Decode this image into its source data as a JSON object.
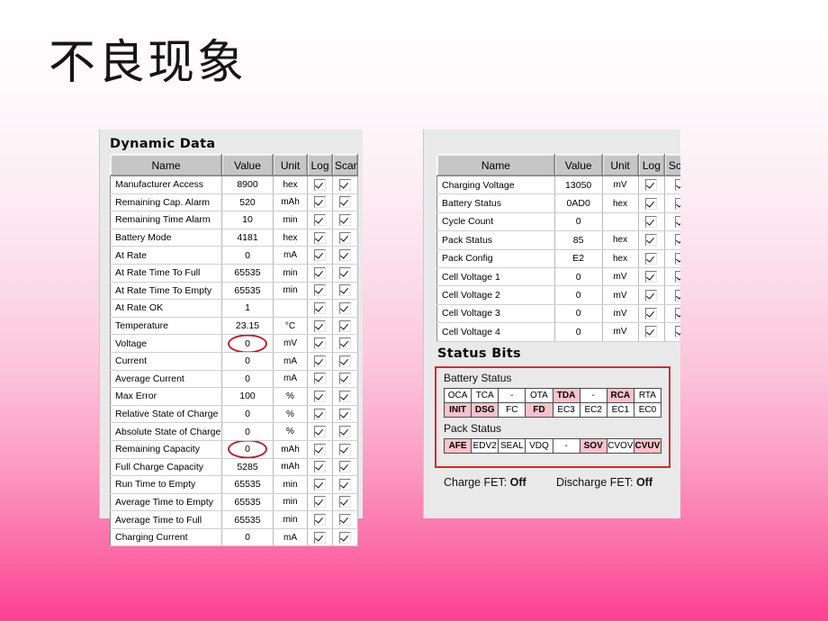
{
  "slide": {
    "title": "不良现象"
  },
  "dynamic_data": {
    "group_title": "Dynamic Data",
    "columns": [
      "Name",
      "Value",
      "Unit",
      "Log",
      "Scan"
    ],
    "rows": [
      {
        "name": "Manufacturer Access",
        "value": "8900",
        "unit": "hex",
        "log": true,
        "scan": true,
        "mark": "none"
      },
      {
        "name": "Remaining Cap. Alarm",
        "value": "520",
        "unit": "mAh",
        "log": true,
        "scan": true,
        "mark": "none"
      },
      {
        "name": "Remaining Time Alarm",
        "value": "10",
        "unit": "min",
        "log": true,
        "scan": true,
        "mark": "none"
      },
      {
        "name": "Battery Mode",
        "value": "4181",
        "unit": "hex",
        "log": true,
        "scan": true,
        "mark": "none"
      },
      {
        "name": "At Rate",
        "value": "0",
        "unit": "mA",
        "log": true,
        "scan": true,
        "mark": "none"
      },
      {
        "name": "At Rate Time To Full",
        "value": "65535",
        "unit": "min",
        "log": true,
        "scan": true,
        "mark": "none"
      },
      {
        "name": "At Rate Time To Empty",
        "value": "65535",
        "unit": "min",
        "log": true,
        "scan": true,
        "mark": "none"
      },
      {
        "name": "At Rate OK",
        "value": "1",
        "unit": "",
        "log": true,
        "scan": true,
        "mark": "none"
      },
      {
        "name": "Temperature",
        "value": "23.15",
        "unit": "°C",
        "log": true,
        "scan": true,
        "mark": "none"
      },
      {
        "name": "Voltage",
        "value": "0",
        "unit": "mV",
        "log": true,
        "scan": true,
        "mark": "ellipse"
      },
      {
        "name": "Current",
        "value": "0",
        "unit": "mA",
        "log": true,
        "scan": true,
        "mark": "none"
      },
      {
        "name": "Average Current",
        "value": "0",
        "unit": "mA",
        "log": true,
        "scan": true,
        "mark": "none"
      },
      {
        "name": "Max Error",
        "value": "100",
        "unit": "%",
        "log": true,
        "scan": true,
        "mark": "none"
      },
      {
        "name": "Relative State of Charge",
        "value": "0",
        "unit": "%",
        "log": true,
        "scan": true,
        "mark": "none"
      },
      {
        "name": "Absolute State of Charge",
        "value": "0",
        "unit": "%",
        "log": true,
        "scan": true,
        "mark": "none"
      },
      {
        "name": "Remaining Capacity",
        "value": "0",
        "unit": "mAh",
        "log": true,
        "scan": true,
        "mark": "ellipse"
      },
      {
        "name": "Full Charge Capacity",
        "value": "5285",
        "unit": "mAh",
        "log": true,
        "scan": true,
        "mark": "none"
      },
      {
        "name": "Run Time to Empty",
        "value": "65535",
        "unit": "min",
        "log": true,
        "scan": true,
        "mark": "none"
      },
      {
        "name": "Average Time to Empty",
        "value": "65535",
        "unit": "min",
        "log": true,
        "scan": true,
        "mark": "none"
      },
      {
        "name": "Average Time to Full",
        "value": "65535",
        "unit": "min",
        "log": true,
        "scan": true,
        "mark": "none"
      },
      {
        "name": "Charging Current",
        "value": "0",
        "unit": "mA",
        "log": true,
        "scan": true,
        "mark": "none"
      }
    ]
  },
  "secondary_data": {
    "columns": [
      "Name",
      "Value",
      "Unit",
      "Log",
      "Scan"
    ],
    "rows": [
      {
        "name": "Charging Voltage",
        "value": "13050",
        "unit": "mV",
        "log": true,
        "scan": true
      },
      {
        "name": "Battery Status",
        "value": "0AD0",
        "unit": "hex",
        "log": true,
        "scan": true
      },
      {
        "name": "Cycle Count",
        "value": "0",
        "unit": "",
        "log": true,
        "scan": true
      },
      {
        "name": "Pack Status",
        "value": "85",
        "unit": "hex",
        "log": true,
        "scan": true
      },
      {
        "name": "Pack Config",
        "value": "E2",
        "unit": "hex",
        "log": true,
        "scan": true
      },
      {
        "name": "Cell Voltage 1",
        "value": "0",
        "unit": "mV",
        "log": true,
        "scan": true
      },
      {
        "name": "Cell Voltage 2",
        "value": "0",
        "unit": "mV",
        "log": true,
        "scan": true
      },
      {
        "name": "Cell Voltage 3",
        "value": "0",
        "unit": "mV",
        "log": true,
        "scan": true
      },
      {
        "name": "Cell Voltage 4",
        "value": "0",
        "unit": "mV",
        "log": true,
        "scan": true
      }
    ]
  },
  "status_bits": {
    "group_title": "Status Bits",
    "battery_status": {
      "label": "Battery Status",
      "row1": [
        {
          "label": "OCA",
          "on": false
        },
        {
          "label": "TCA",
          "on": false
        },
        {
          "label": "-",
          "on": false
        },
        {
          "label": "OTA",
          "on": false
        },
        {
          "label": "TDA",
          "on": true
        },
        {
          "label": "-",
          "on": false
        },
        {
          "label": "RCA",
          "on": true
        },
        {
          "label": "RTA",
          "on": false
        }
      ],
      "row2": [
        {
          "label": "INIT",
          "on": true
        },
        {
          "label": "DSG",
          "on": true
        },
        {
          "label": "FC",
          "on": false
        },
        {
          "label": "FD",
          "on": true
        },
        {
          "label": "EC3",
          "on": false
        },
        {
          "label": "EC2",
          "on": false
        },
        {
          "label": "EC1",
          "on": false
        },
        {
          "label": "EC0",
          "on": false
        }
      ]
    },
    "pack_status": {
      "label": "Pack Status",
      "row1": [
        {
          "label": "AFE",
          "on": true
        },
        {
          "label": "EDV2",
          "on": false
        },
        {
          "label": "SEAL",
          "on": false
        },
        {
          "label": "VDQ",
          "on": false
        },
        {
          "label": "-",
          "on": false
        },
        {
          "label": "SOV",
          "on": true
        },
        {
          "label": "CVOV",
          "on": false
        },
        {
          "label": "CVUV",
          "on": true
        }
      ]
    },
    "fets": {
      "charge_label": "Charge FET:",
      "charge_value": "Off",
      "discharge_label": "Discharge FET:",
      "discharge_value": "Off"
    }
  },
  "colors": {
    "annotation_red": "#cf2d26",
    "bit_on_pink": "#f9c2cb",
    "panel_gray": "#e9e9e9",
    "header_gray": "#c6c6c6"
  }
}
